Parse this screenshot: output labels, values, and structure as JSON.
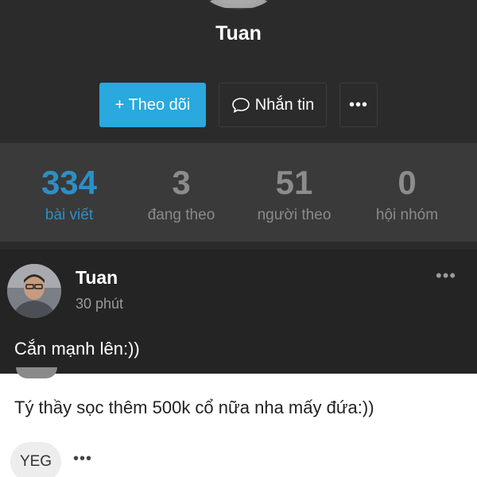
{
  "profile": {
    "name": "Tuan"
  },
  "actions": {
    "follow_label": "+ Theo dõi",
    "message_label": "Nhắn tin",
    "more_label": "•••"
  },
  "stats": [
    {
      "value": "334",
      "label": "bài viết",
      "active": true
    },
    {
      "value": "3",
      "label": "đang theo",
      "active": false
    },
    {
      "value": "51",
      "label": "người theo",
      "active": false
    },
    {
      "value": "0",
      "label": "hội nhóm",
      "active": false
    }
  ],
  "post": {
    "author": "Tuan",
    "time": "30 phút",
    "more_label": "•••",
    "text": "Cắn mạnh lên:))"
  },
  "comment": {
    "text": "Tý thầy sọc thêm 500k cổ nữa nha mấy đứa:))",
    "chip_label": "YEG",
    "more_label": "•••"
  },
  "colors": {
    "accent": "#29a9dd",
    "active_stat": "#2d8fc6",
    "background": "#2b2b2b",
    "stats_bg": "#3a3a3a"
  }
}
